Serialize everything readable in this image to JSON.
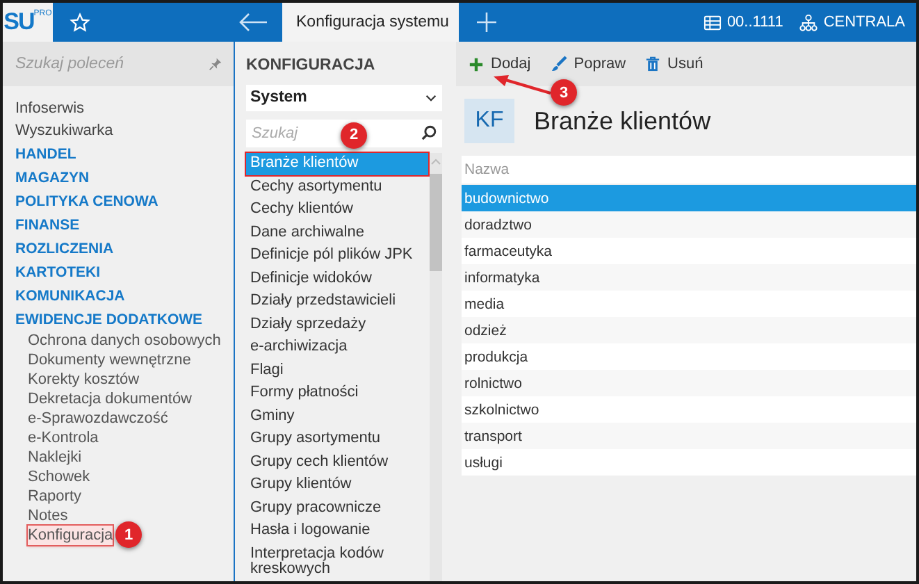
{
  "top_bar": {
    "logo": "SU",
    "logo_badge": "PRO",
    "active_tab": "Konfiguracja systemu",
    "database": "00..1111",
    "branch": "CENTRALA"
  },
  "sidebar": {
    "search_placeholder": "Szukaj poleceń",
    "items": [
      {
        "label": "Infoserwis",
        "kind": "link"
      },
      {
        "label": "Wyszukiwarka",
        "kind": "link"
      },
      {
        "label": "HANDEL",
        "kind": "section"
      },
      {
        "label": "MAGAZYN",
        "kind": "section"
      },
      {
        "label": "POLITYKA CENOWA",
        "kind": "section"
      },
      {
        "label": "FINANSE",
        "kind": "section"
      },
      {
        "label": "ROZLICZENIA",
        "kind": "section"
      },
      {
        "label": "KARTOTEKI",
        "kind": "section"
      },
      {
        "label": "KOMUNIKACJA",
        "kind": "section"
      },
      {
        "label": "EWIDENCJE DODATKOWE",
        "kind": "section",
        "children": [
          {
            "label": "Ochrona danych osobowych"
          },
          {
            "label": "Dokumenty wewnętrzne"
          },
          {
            "label": "Korekty kosztów"
          },
          {
            "label": "Dekretacja dokumentów"
          },
          {
            "label": "e-Sprawozdawczość"
          },
          {
            "label": "e-Kontrola"
          },
          {
            "label": "Naklejki"
          },
          {
            "label": "Schowek"
          },
          {
            "label": "Raporty"
          },
          {
            "label": "Notes"
          },
          {
            "label": "Konfiguracja",
            "callout": "1"
          }
        ]
      }
    ]
  },
  "config": {
    "heading": "KONFIGURACJA",
    "dropdown": "System",
    "search_placeholder": "Szukaj",
    "items": [
      {
        "label": "Branże klientów",
        "selected": true,
        "callout": "2"
      },
      {
        "label": "Cechy asortymentu",
        "selected": false
      },
      {
        "label": "Cechy klientów",
        "selected": false
      },
      {
        "label": "Dane archiwalne",
        "selected": false
      },
      {
        "label": "Definicje pól plików JPK",
        "selected": false
      },
      {
        "label": "Definicje widoków",
        "selected": false
      },
      {
        "label": "Działy przedstawicieli",
        "selected": false
      },
      {
        "label": "Działy sprzedaży",
        "selected": false
      },
      {
        "label": "e-archiwizacja",
        "selected": false
      },
      {
        "label": "Flagi",
        "selected": false
      },
      {
        "label": "Formy płatności",
        "selected": false
      },
      {
        "label": "Gminy",
        "selected": false
      },
      {
        "label": "Grupy asortymentu",
        "selected": false
      },
      {
        "label": "Grupy cech klientów",
        "selected": false
      },
      {
        "label": "Grupy klientów",
        "selected": false
      },
      {
        "label": "Grupy pracownicze",
        "selected": false
      },
      {
        "label": "Hasła i logowanie",
        "selected": false
      },
      {
        "label": "Interpretacja kodów kreskowych",
        "selected": false
      }
    ]
  },
  "records": {
    "toolbar": [
      {
        "label": "Dodaj",
        "kind": "add",
        "callout": "3"
      },
      {
        "label": "Popraw",
        "kind": "edit"
      },
      {
        "label": "Usuń",
        "kind": "delete"
      }
    ],
    "badge": "KF",
    "title": "Branże klientów",
    "table": {
      "columns": [
        "Nazwa"
      ],
      "rows": [
        {
          "cells": [
            "budownictwo"
          ],
          "selected": true
        },
        {
          "cells": [
            "doradztwo"
          ],
          "selected": false
        },
        {
          "cells": [
            "farmaceutyka"
          ],
          "selected": false
        },
        {
          "cells": [
            "informatyka"
          ],
          "selected": false
        },
        {
          "cells": [
            "media"
          ],
          "selected": false
        },
        {
          "cells": [
            "odzież"
          ],
          "selected": false
        },
        {
          "cells": [
            "produkcja"
          ],
          "selected": false
        },
        {
          "cells": [
            "rolnictwo"
          ],
          "selected": false
        },
        {
          "cells": [
            "szkolnictwo"
          ],
          "selected": false
        },
        {
          "cells": [
            "transport"
          ],
          "selected": false
        },
        {
          "cells": [
            "usługi"
          ],
          "selected": false
        }
      ]
    }
  }
}
